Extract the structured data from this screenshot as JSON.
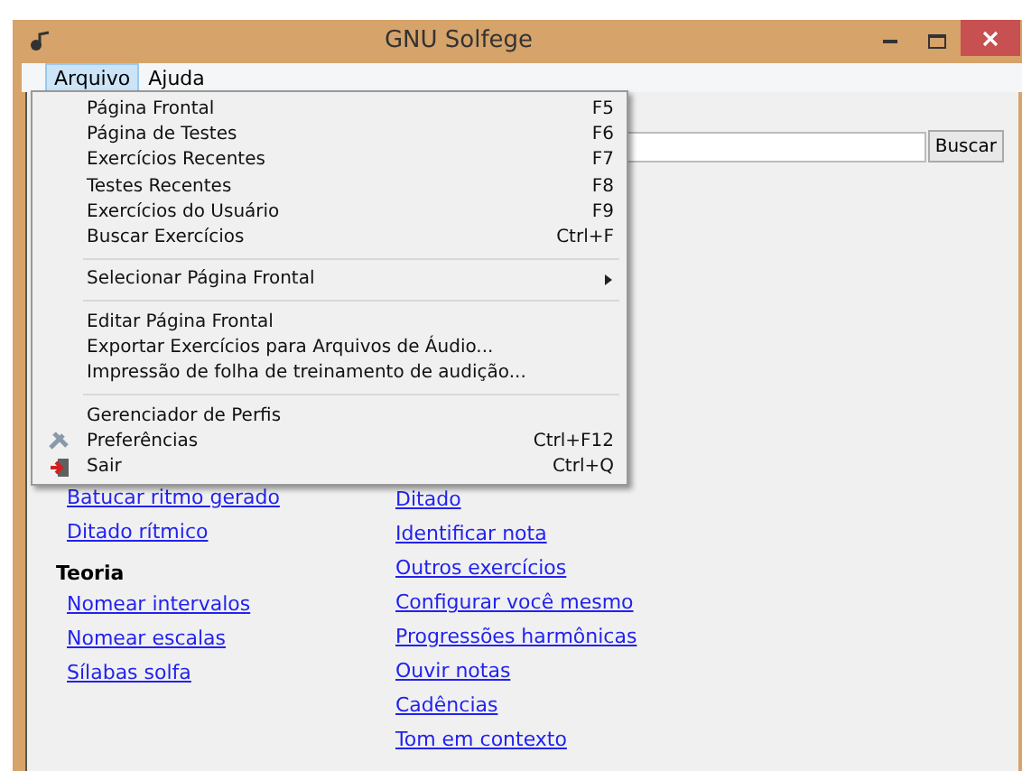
{
  "window": {
    "title": "GNU Solfege"
  },
  "menubar": [
    {
      "label": "Arquivo",
      "selected": true
    },
    {
      "label": "Ajuda",
      "selected": false
    }
  ],
  "search": {
    "button": "Buscar"
  },
  "links_left": [
    {
      "kind": "link",
      "label": "Batucar ritmo gerado"
    },
    {
      "kind": "link",
      "label": "Ditado rítmico"
    },
    {
      "kind": "heading",
      "label": "Teoria"
    },
    {
      "kind": "link",
      "label": "Nomear intervalos"
    },
    {
      "kind": "link",
      "label": "Nomear escalas"
    },
    {
      "kind": "link",
      "label": "Sílabas solfa"
    }
  ],
  "links_right": [
    {
      "kind": "link",
      "label": "Ditado"
    },
    {
      "kind": "link",
      "label": "Identificar nota"
    },
    {
      "kind": "link",
      "label": "Outros exercícios"
    },
    {
      "kind": "link",
      "label": "Configurar você mesmo"
    },
    {
      "kind": "link",
      "label": "Progressões harmônicas"
    },
    {
      "kind": "link",
      "label": "Ouvir notas"
    },
    {
      "kind": "link",
      "label": "Cadências"
    },
    {
      "kind": "link",
      "label": "Tom em contexto"
    }
  ],
  "menu": [
    {
      "kind": "item",
      "label": "Página Frontal",
      "shortcut": "F5"
    },
    {
      "kind": "item",
      "label": "Página de Testes",
      "shortcut": "F6"
    },
    {
      "kind": "item",
      "label": "Exercícios Recentes",
      "shortcut": "F7"
    },
    {
      "kind": "item",
      "label": "Testes Recentes",
      "shortcut": "F8"
    },
    {
      "kind": "item",
      "label": "Exercícios do Usuário",
      "shortcut": "F9"
    },
    {
      "kind": "item",
      "label": "Buscar Exercícios",
      "shortcut": "Ctrl+F"
    },
    {
      "kind": "separator"
    },
    {
      "kind": "submenu",
      "label": "Selecionar Página Frontal"
    },
    {
      "kind": "separator"
    },
    {
      "kind": "item",
      "label": "Editar Página Frontal"
    },
    {
      "kind": "item",
      "label": "Exportar Exercícios para Arquivos de Áudio..."
    },
    {
      "kind": "item",
      "label": "Impressão de folha de treinamento de audição..."
    },
    {
      "kind": "separator"
    },
    {
      "kind": "item",
      "label": "Gerenciador de Perfis"
    },
    {
      "kind": "preferences",
      "label": "Preferências",
      "shortcut": "Ctrl+F12"
    },
    {
      "kind": "exit",
      "label": "Sair",
      "shortcut": "Ctrl+Q"
    }
  ]
}
